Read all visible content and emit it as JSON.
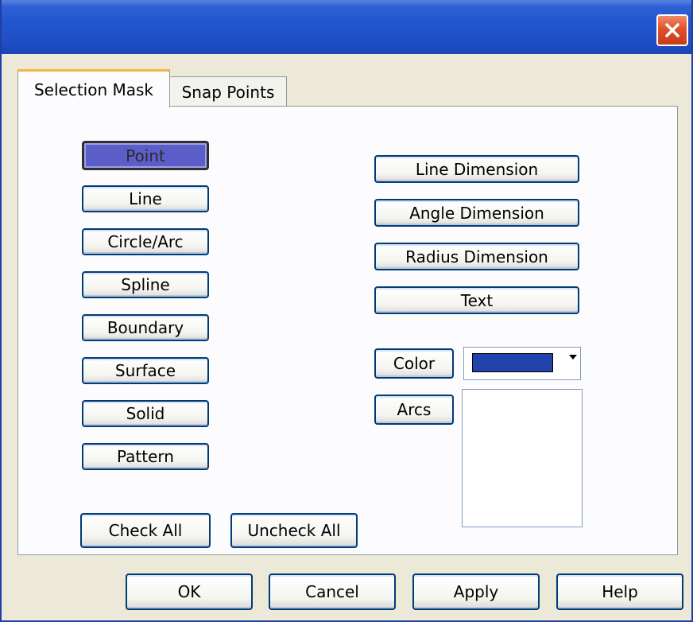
{
  "window": {
    "title": "",
    "close_label": "Close"
  },
  "tabs": [
    {
      "label": "Selection Mask",
      "active": true
    },
    {
      "label": "Snap Points",
      "active": false
    }
  ],
  "selection_mask": {
    "entity_buttons": [
      {
        "label": "Point",
        "pressed": true
      },
      {
        "label": "Line",
        "pressed": false
      },
      {
        "label": "Circle/Arc",
        "pressed": false
      },
      {
        "label": "Spline",
        "pressed": false
      },
      {
        "label": "Boundary",
        "pressed": false
      },
      {
        "label": "Surface",
        "pressed": false
      },
      {
        "label": "Solid",
        "pressed": false
      },
      {
        "label": "Pattern",
        "pressed": false
      }
    ],
    "annotation_buttons": [
      {
        "label": "Line Dimension"
      },
      {
        "label": "Angle Dimension"
      },
      {
        "label": "Radius Dimension"
      },
      {
        "label": "Text"
      }
    ],
    "color_button": "Color",
    "color_value": "#2244aa",
    "arcs_button": "Arcs",
    "check_all": "Check All",
    "uncheck_all": "Uncheck All"
  },
  "footer": {
    "ok": "OK",
    "cancel": "Cancel",
    "apply": "Apply",
    "help": "Help"
  },
  "colors": {
    "title_bar": "#2255cf",
    "pressed_button": "#5b5ec8",
    "tab_highlight": "#f5b63c"
  }
}
